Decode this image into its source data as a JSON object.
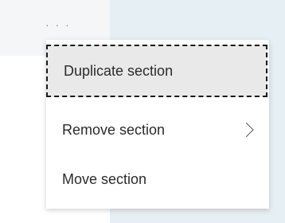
{
  "more_button": {
    "label": "· · ·"
  },
  "menu": {
    "items": [
      {
        "label": "Duplicate section",
        "focused": true
      },
      {
        "label": "Remove section",
        "icon": "chevron-right-icon"
      },
      {
        "label": "Move section"
      }
    ]
  }
}
